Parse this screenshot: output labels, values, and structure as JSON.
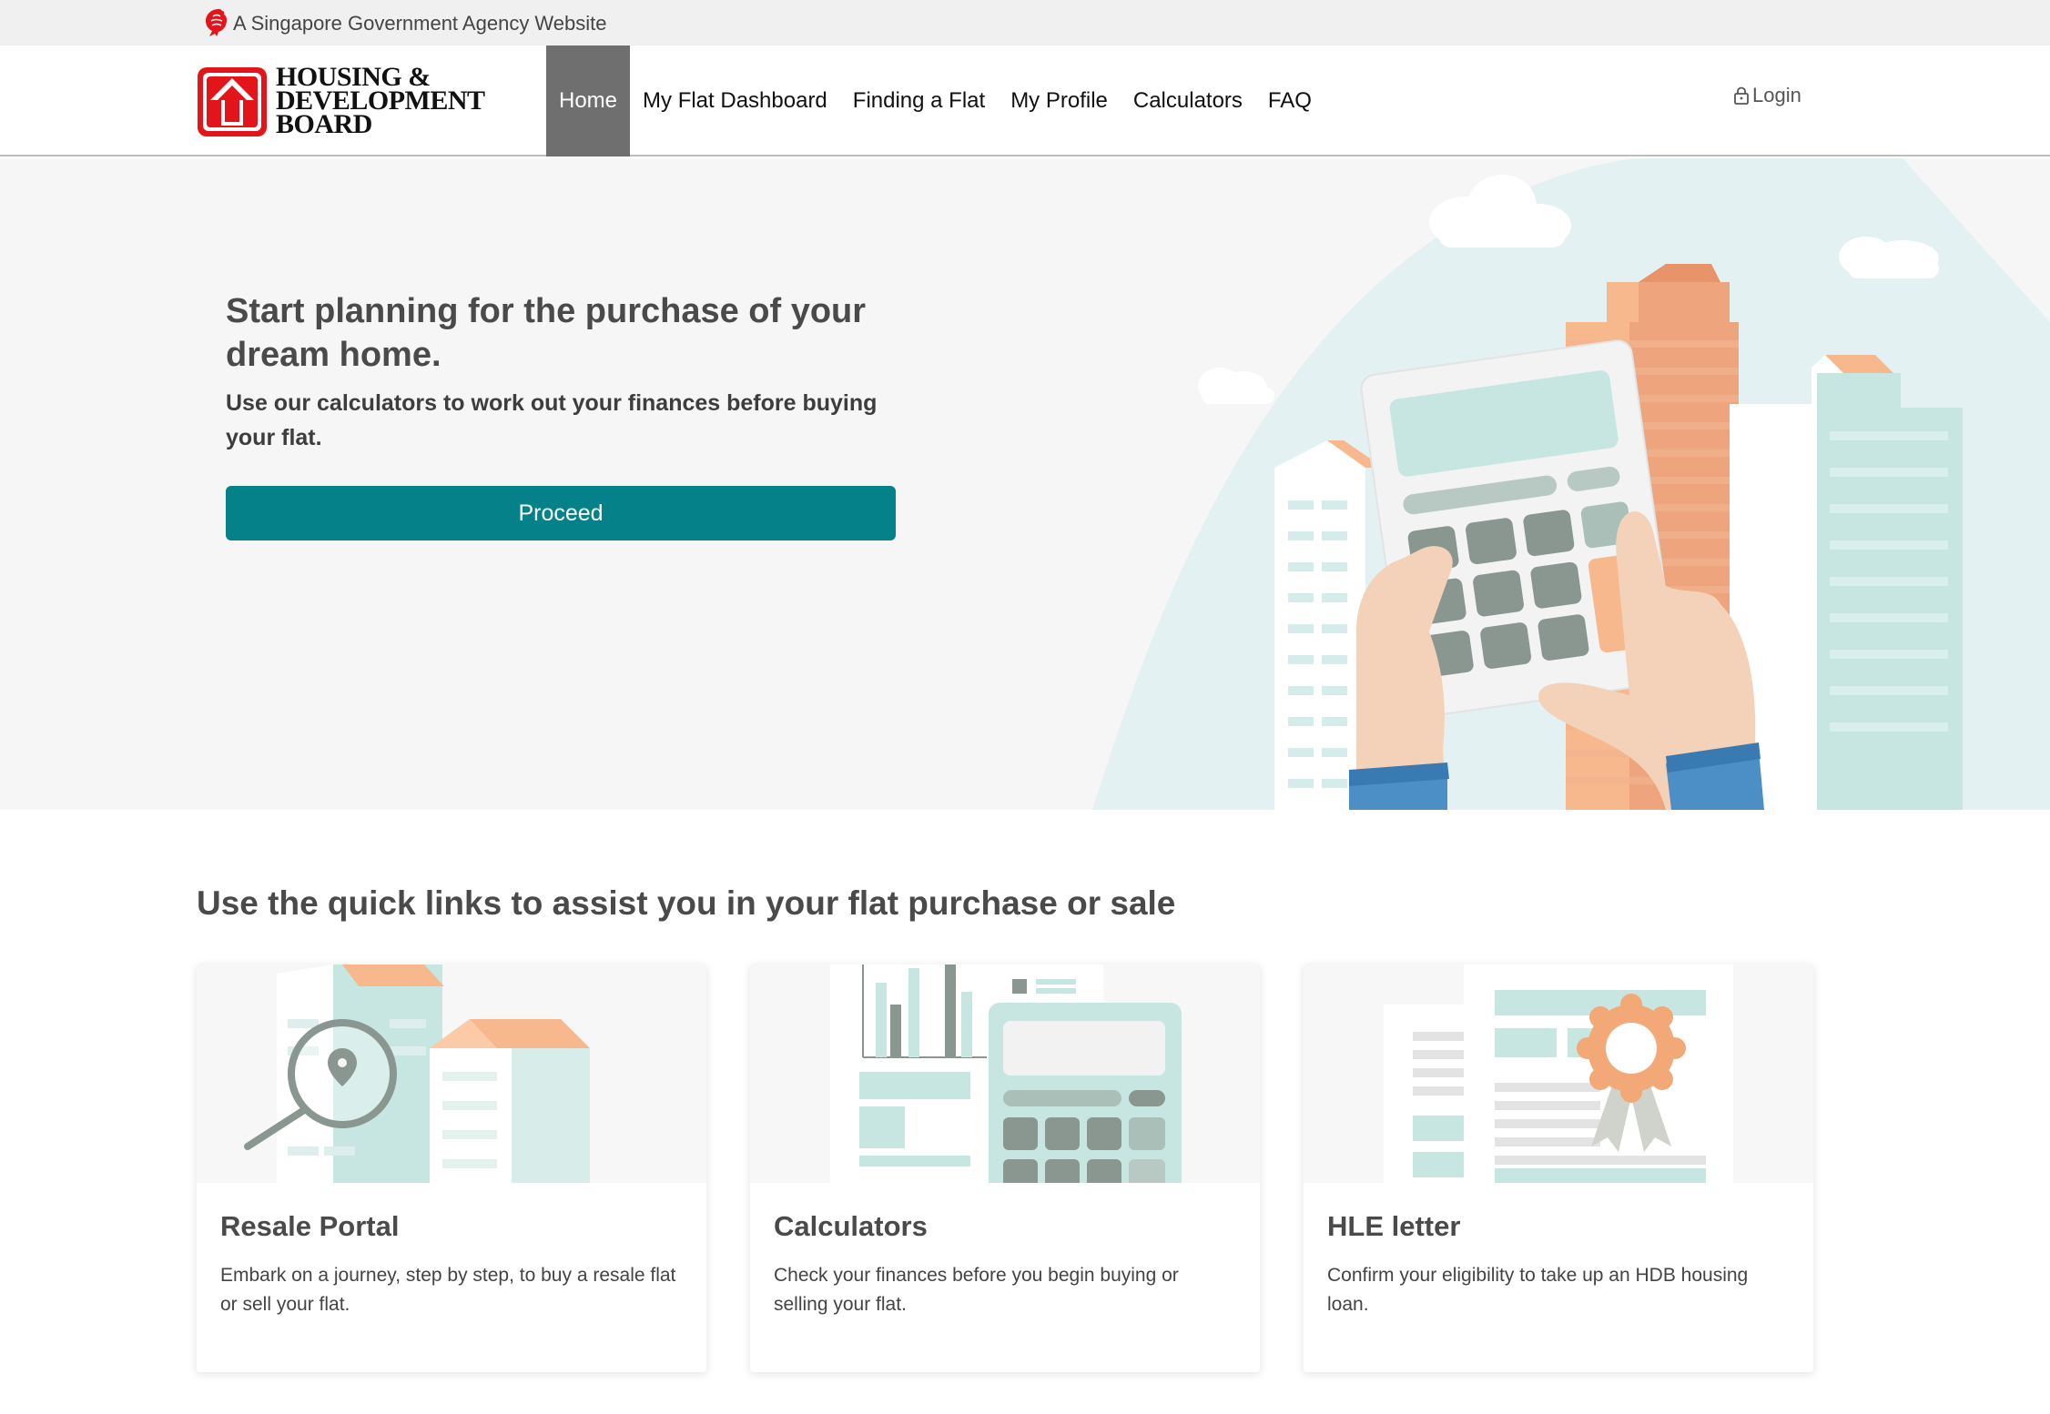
{
  "masthead": {
    "text": "A Singapore Government Agency Website",
    "icon": "lion-head-icon"
  },
  "logo": {
    "line1": "HOUSING &",
    "line2": "DEVELOPMENT",
    "line3": "BOARD",
    "icon": "hdb-house-arrow-icon",
    "brand_color": "#e3151a"
  },
  "nav": {
    "items": [
      {
        "label": "Home",
        "active": true
      },
      {
        "label": "My Flat Dashboard",
        "active": false
      },
      {
        "label": "Finding a Flat",
        "active": false
      },
      {
        "label": "My Profile",
        "active": false
      },
      {
        "label": "Calculators",
        "active": false
      },
      {
        "label": "FAQ",
        "active": false
      }
    ],
    "login_label": "Login",
    "login_icon": "lock-icon"
  },
  "hero": {
    "title": "Start planning for the purchase of your dream home.",
    "subtitle": "Use our calculators to work out your finances before buying your flat.",
    "button_label": "Proceed",
    "button_color": "#058289",
    "illustration": "calculator-cityscape-illustration"
  },
  "quick_links": {
    "heading": "Use the quick links to assist you in your flat purchase or sale",
    "cards": [
      {
        "title": "Resale Portal",
        "description": "Embark on a journey, step by step, to buy a resale flat or sell your flat.",
        "illustration": "buildings-magnifier-illustration"
      },
      {
        "title": "Calculators",
        "description": "Check your finances before you begin buying or selling your flat.",
        "illustration": "calculator-chart-illustration"
      },
      {
        "title": "HLE letter",
        "description": "Confirm your eligibility to take up an HDB housing loan.",
        "illustration": "certificate-ribbon-illustration"
      }
    ]
  }
}
